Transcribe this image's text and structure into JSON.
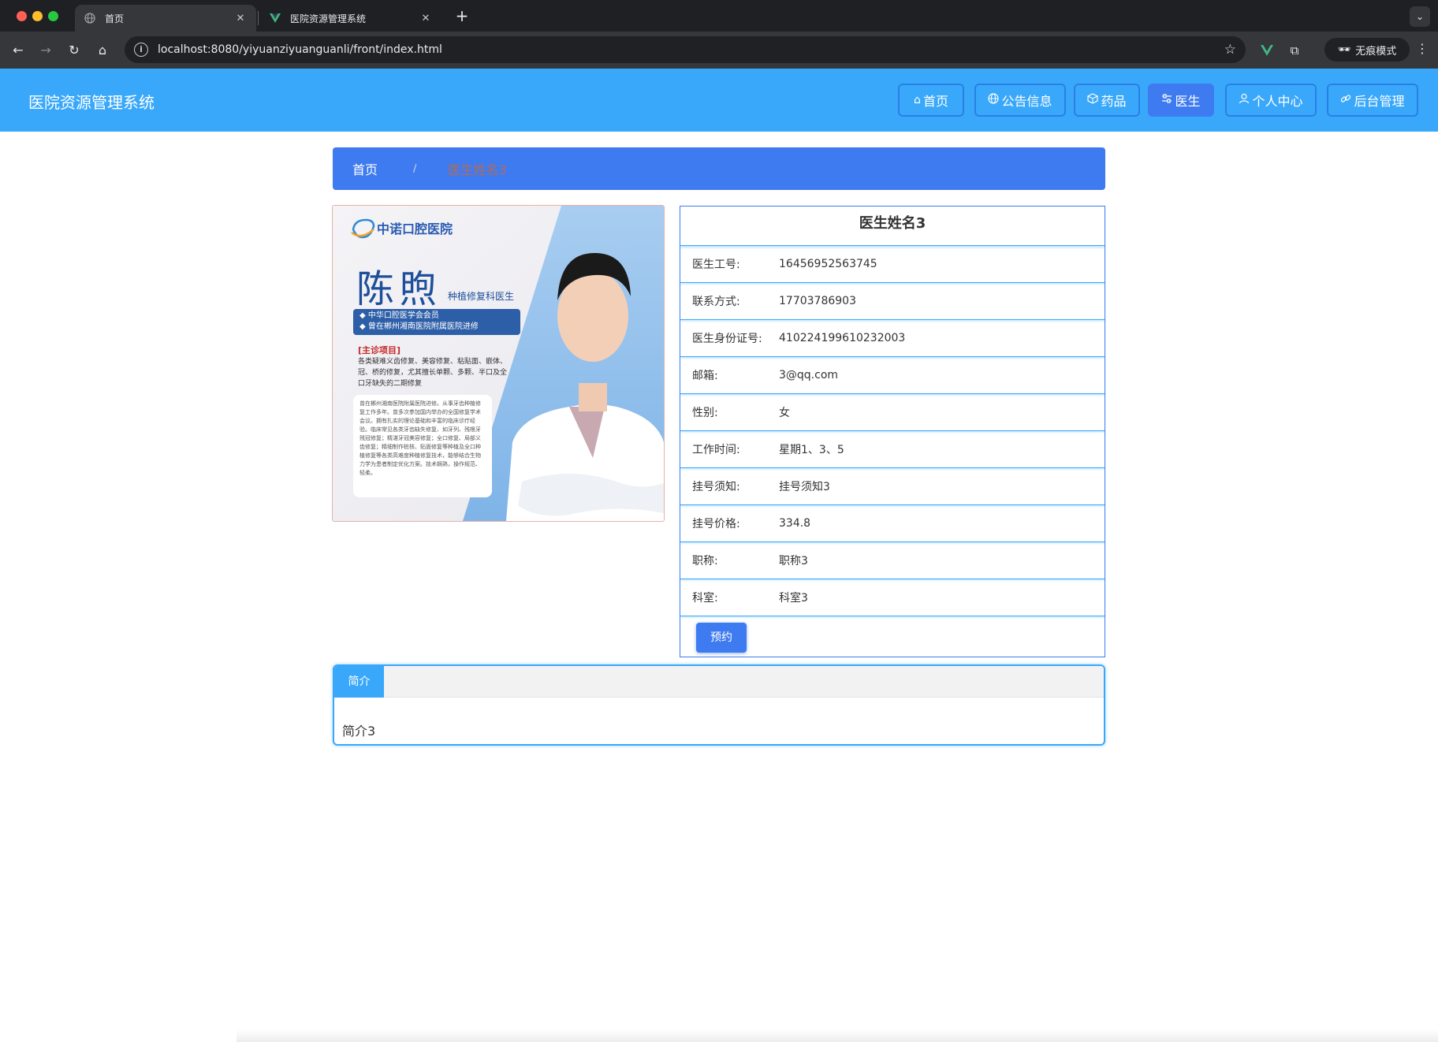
{
  "browser": {
    "tabs": [
      {
        "title": "首页",
        "favicon": "globe-icon",
        "active": true
      },
      {
        "title": "医院资源管理系统",
        "favicon": "vue-icon",
        "active": false
      }
    ],
    "url": "localhost:8080/yiyuanziyuanguanli/front/index.html",
    "incognito_label": "无痕模式"
  },
  "site": {
    "title": "医院资源管理系统",
    "nav": [
      {
        "label": "首页",
        "icon": "home-icon"
      },
      {
        "label": "公告信息",
        "icon": "globe-icon"
      },
      {
        "label": "药品",
        "icon": "box-icon"
      },
      {
        "label": "医生",
        "icon": "sliders-icon",
        "active": true
      },
      {
        "label": "个人中心",
        "icon": "user-icon"
      },
      {
        "label": "后台管理",
        "icon": "link-icon"
      }
    ]
  },
  "breadcrumb": {
    "home": "首页",
    "separator": "/",
    "current": "医生姓名3"
  },
  "poster": {
    "hospital": "中诺口腔医院",
    "doctor_name": "陈煦",
    "specialty": "种植修复科医生",
    "credentials": [
      "中华口腔医学会会员",
      "曾在郴州湘南医院附属医院进修"
    ],
    "main_title": "[主诊项目]",
    "main_text": "各类疑难义齿修复、美容修复、粘贴面、嵌体、冠、桥的修复，尤其擅长单颗、多颗、半口及全口牙缺失的二期修复",
    "bio_text": "曾在郴州湘南医院附属医院进修。从事牙齿种植修复工作多年。曾多次参加国内举办的全国修复学术会议。拥有扎实的理论基础和丰富的临床诊疗经验。临床常见各类牙齿缺失修复、如牙列、残根牙残冠修复；精湛牙冠美容修复；全口修复、局部义齿修复；精细制作桩核、贴面修复等种植及全口种植修复等各类高难度种植修复技术，能够结合生物力学为患者制定优化方案。技术娴熟，操作规范、轻柔。"
  },
  "doctor": {
    "name": "医生姓名3",
    "fields": [
      {
        "label": "医生工号:",
        "value": "16456952563745"
      },
      {
        "label": "联系方式:",
        "value": "17703786903"
      },
      {
        "label": "医生身份证号:",
        "value": "410224199610232003"
      },
      {
        "label": "邮箱:",
        "value": "3@qq.com"
      },
      {
        "label": "性别:",
        "value": "女"
      },
      {
        "label": "工作时间:",
        "value": "星期1、3、5"
      },
      {
        "label": "挂号须知:",
        "value": "挂号须知3"
      },
      {
        "label": "挂号价格:",
        "value": "334.8"
      },
      {
        "label": "职称:",
        "value": "职称3"
      },
      {
        "label": "科室:",
        "value": "科室3"
      }
    ],
    "reserve_label": "预约"
  },
  "intro": {
    "tab_label": "简介",
    "content": "简介3"
  },
  "colors": {
    "header_bg": "#3aa8fa",
    "accent": "#3f7bf0",
    "breadcrumb_current": "#b46a55"
  }
}
